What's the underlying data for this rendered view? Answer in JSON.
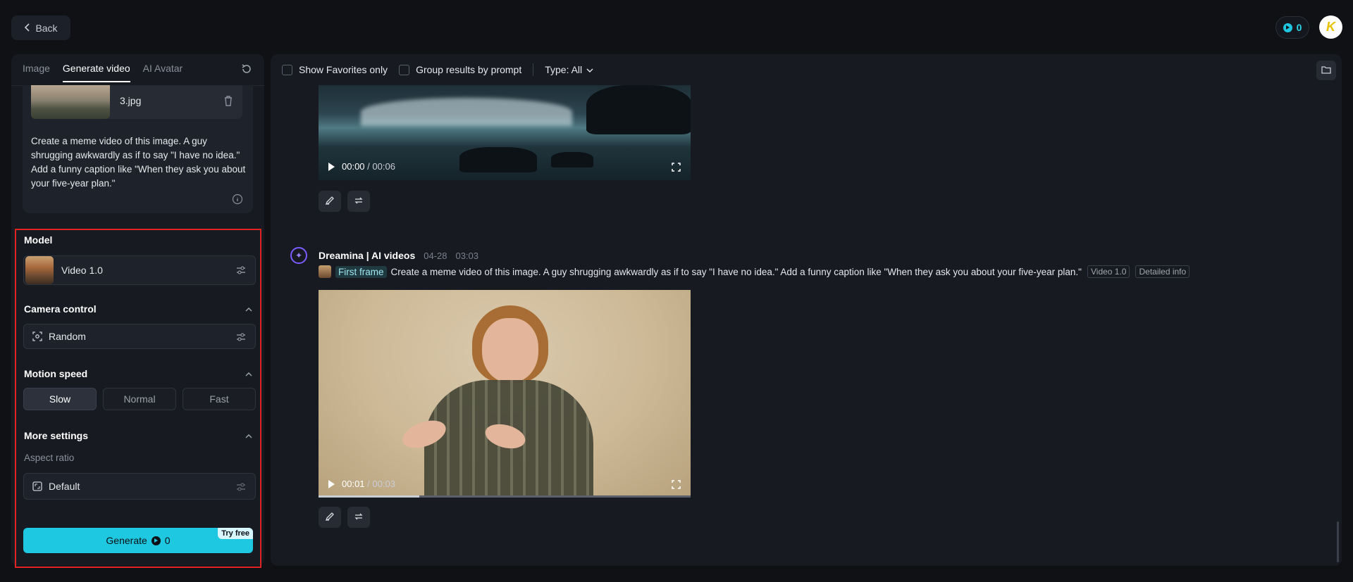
{
  "topbar": {
    "back_label": "Back",
    "credits": "0",
    "avatar_letter": "K"
  },
  "left": {
    "tabs": [
      {
        "label": "Image",
        "active": false
      },
      {
        "label": "Generate video",
        "active": true
      },
      {
        "label": "AI Avatar",
        "active": false
      }
    ],
    "file_name": "3.jpg",
    "prompt": "Create a meme video of this image. A guy shrugging awkwardly as if to say \"I have no idea.\" Add a funny caption like \"When they ask you about your five-year plan.\"",
    "model": {
      "title": "Model",
      "value": "Video 1.0"
    },
    "camera": {
      "title": "Camera control",
      "value": "Random"
    },
    "motion": {
      "title": "Motion speed",
      "options": [
        "Slow",
        "Normal",
        "Fast"
      ],
      "selected": "Slow"
    },
    "more": {
      "title": "More settings",
      "aspect_label": "Aspect ratio",
      "aspect_value": "Default"
    },
    "generate": {
      "label": "Generate",
      "cost": "0",
      "badge": "Try free"
    },
    "colors": {
      "accent": "#1ec8e0",
      "highlight_border": "#e02424"
    }
  },
  "right": {
    "filters": {
      "favorites_label": "Show Favorites only",
      "group_label": "Group results by prompt",
      "type_label": "Type: All"
    },
    "video1": {
      "time_current": "00:00",
      "time_total": "00:06"
    },
    "generation": {
      "source": "Dreamina | AI videos",
      "date": "04-28",
      "time": "03:03",
      "first_frame_label": "First frame",
      "prompt": "Create a meme video of this image. A guy shrugging awkwardly as if to say \"I have no idea.\" Add a funny caption like \"When they ask you about your five-year plan.\"",
      "model_tag": "Video 1.0",
      "info_tag": "Detailed info"
    },
    "video2": {
      "time_current": "00:01",
      "time_total": "00:03",
      "progress": 0.27
    }
  }
}
